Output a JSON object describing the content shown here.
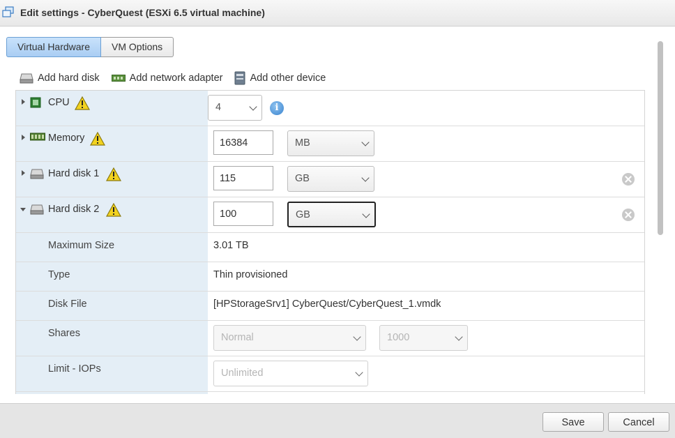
{
  "window": {
    "title": "Edit settings - CyberQuest (ESXi 6.5 virtual machine)"
  },
  "tabs": [
    {
      "label": "Virtual Hardware",
      "active": true
    },
    {
      "label": "VM Options",
      "active": false
    }
  ],
  "toolbar": {
    "add_hard_disk": "Add hard disk",
    "add_network_adapter": "Add network adapter",
    "add_other_device": "Add other device"
  },
  "hardware": {
    "cpu": {
      "label": "CPU",
      "value": "4"
    },
    "memory": {
      "label": "Memory",
      "value": "16384",
      "unit": "MB"
    },
    "hard_disk_1": {
      "label": "Hard disk 1",
      "value": "115",
      "unit": "GB"
    },
    "hard_disk_2": {
      "label": "Hard disk 2",
      "value": "100",
      "unit": "GB",
      "expanded": true,
      "details": {
        "max_size": {
          "label": "Maximum Size",
          "value": "3.01 TB"
        },
        "type": {
          "label": "Type",
          "value": "Thin provisioned"
        },
        "disk_file": {
          "label": "Disk File",
          "value": "[HPStorageSrv1] CyberQuest/CyberQuest_1.vmdk"
        },
        "shares": {
          "label": "Shares",
          "level": "Normal",
          "value": "1000"
        },
        "limit_iops": {
          "label": "Limit - IOPs",
          "value": "Unlimited"
        }
      }
    }
  },
  "footer": {
    "save": "Save",
    "cancel": "Cancel"
  },
  "colors": {
    "label_bg": "#e4eef6",
    "active_tab": "#a9cdf3",
    "warning": "#f2d21f",
    "info": "#3a84cf"
  }
}
